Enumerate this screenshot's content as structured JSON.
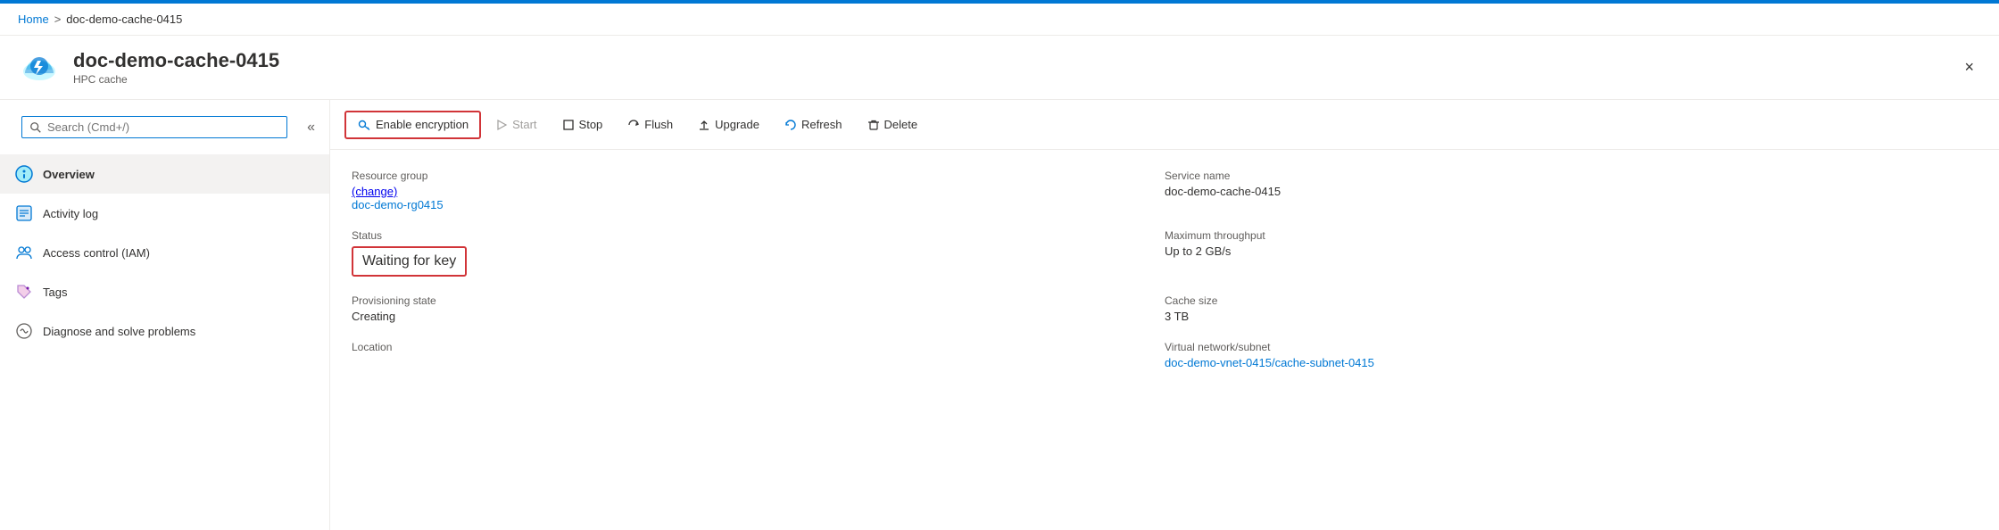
{
  "topBar": {},
  "breadcrumb": {
    "home": "Home",
    "separator": ">",
    "current": "doc-demo-cache-0415"
  },
  "header": {
    "title": "doc-demo-cache-0415",
    "subtitle": "HPC cache",
    "closeLabel": "×"
  },
  "sidebar": {
    "searchPlaceholder": "Search (Cmd+/)",
    "collapseLabel": "«",
    "items": [
      {
        "id": "overview",
        "label": "Overview",
        "active": true
      },
      {
        "id": "activity-log",
        "label": "Activity log",
        "active": false
      },
      {
        "id": "access-control",
        "label": "Access control (IAM)",
        "active": false
      },
      {
        "id": "tags",
        "label": "Tags",
        "active": false
      },
      {
        "id": "diagnose",
        "label": "Diagnose and solve problems",
        "active": false
      }
    ]
  },
  "toolbar": {
    "enableEncryption": "Enable encryption",
    "start": "Start",
    "stop": "Stop",
    "flush": "Flush",
    "upgrade": "Upgrade",
    "refresh": "Refresh",
    "delete": "Delete"
  },
  "details": {
    "resourceGroupLabel": "Resource group",
    "resourceGroupChange": "(change)",
    "resourceGroupValue": "doc-demo-rg0415",
    "statusLabel": "Status",
    "statusValue": "Waiting for key",
    "provisioningLabel": "Provisioning state",
    "provisioningValue": "Creating",
    "locationLabel": "Location",
    "locationValue": "",
    "serviceNameLabel": "Service name",
    "serviceNameValue": "doc-demo-cache-0415",
    "maxThroughputLabel": "Maximum throughput",
    "maxThroughputValue": "Up to 2 GB/s",
    "cacheSizeLabel": "Cache size",
    "cacheSizeValue": "3 TB",
    "virtualNetworkLabel": "Virtual network/subnet",
    "virtualNetworkValue": "doc-demo-vnet-0415/cache-subnet-0415"
  },
  "colors": {
    "accent": "#0078d4",
    "danger": "#d13438",
    "border": "#edebe9",
    "subtle": "#605e5c"
  }
}
